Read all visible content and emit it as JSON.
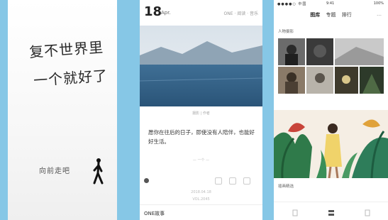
{
  "splash": {
    "calligraphy_line1": "复不世界里",
    "calligraphy_line2": "一个就好了",
    "enter_label": "向前走吧"
  },
  "post": {
    "day": "18",
    "month": "Apr.",
    "nav": "ONE · 阅读 · 音乐",
    "photo_caption": "摄影 | 作者",
    "quote": "愿你在往后的日子，即使没有人陪伴，也能好好生活。",
    "small_text": "— 一个 —",
    "date_line": "2018.04.18",
    "date_line2": "VOL.2045",
    "section_title": "ONE故事"
  },
  "gallery": {
    "status_signal": "●●●●○ 中国",
    "status_time": "9:41",
    "status_battery": "100%",
    "tabs": [
      "图库",
      "专题",
      "排行"
    ],
    "active_tab": "图库",
    "more": "…",
    "section1_label": "人物摄影",
    "section2_label": "插画精选"
  },
  "colors": {
    "background": "#86c7e6",
    "sky_top": "#e8eef3",
    "sea": "#2f5f86",
    "banner_bg": "#f5eee4"
  }
}
